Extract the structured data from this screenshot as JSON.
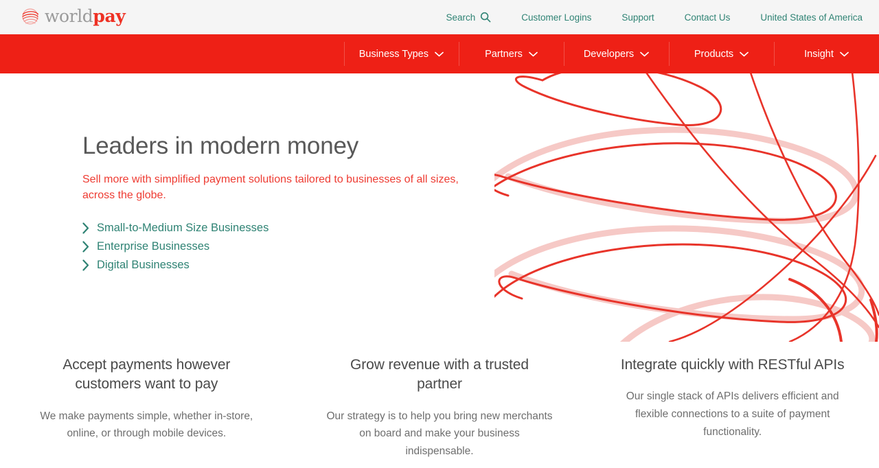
{
  "brand": {
    "logo_world": "world",
    "logo_pay": "pay",
    "logo_mark_name": "worldpay-globe-icon",
    "red": "#ee2016",
    "teal": "#2f8374",
    "heading_gray": "#595959"
  },
  "utility_bar": {
    "search_label": "Search",
    "links": [
      {
        "label": "Customer Logins"
      },
      {
        "label": "Support"
      },
      {
        "label": "Contact Us"
      },
      {
        "label": "United States of America"
      }
    ]
  },
  "main_nav": {
    "items": [
      {
        "label": "Business Types"
      },
      {
        "label": "Partners"
      },
      {
        "label": "Developers"
      },
      {
        "label": "Products"
      },
      {
        "label": "Insight"
      }
    ]
  },
  "hero": {
    "title": "Leaders in modern money",
    "subtitle": "Sell more with simplified payment solutions tailored to businesses of all sizes, across the globe.",
    "links": [
      {
        "label": "Small-to-Medium Size Businesses"
      },
      {
        "label": "Enterprise Businesses"
      },
      {
        "label": "Digital Businesses"
      }
    ]
  },
  "features": [
    {
      "title": "Accept payments however customers want to pay",
      "body": "We make payments simple, whether in-store, online, or through mobile devices."
    },
    {
      "title": "Grow revenue with a trusted partner",
      "body": "Our strategy is to help you bring new merchants on board and make your business indispensable."
    },
    {
      "title": "Integrate quickly with RESTful APIs",
      "body": "Our single stack of APIs delivers efficient and flexible connections to a suite of payment functionality."
    }
  ]
}
